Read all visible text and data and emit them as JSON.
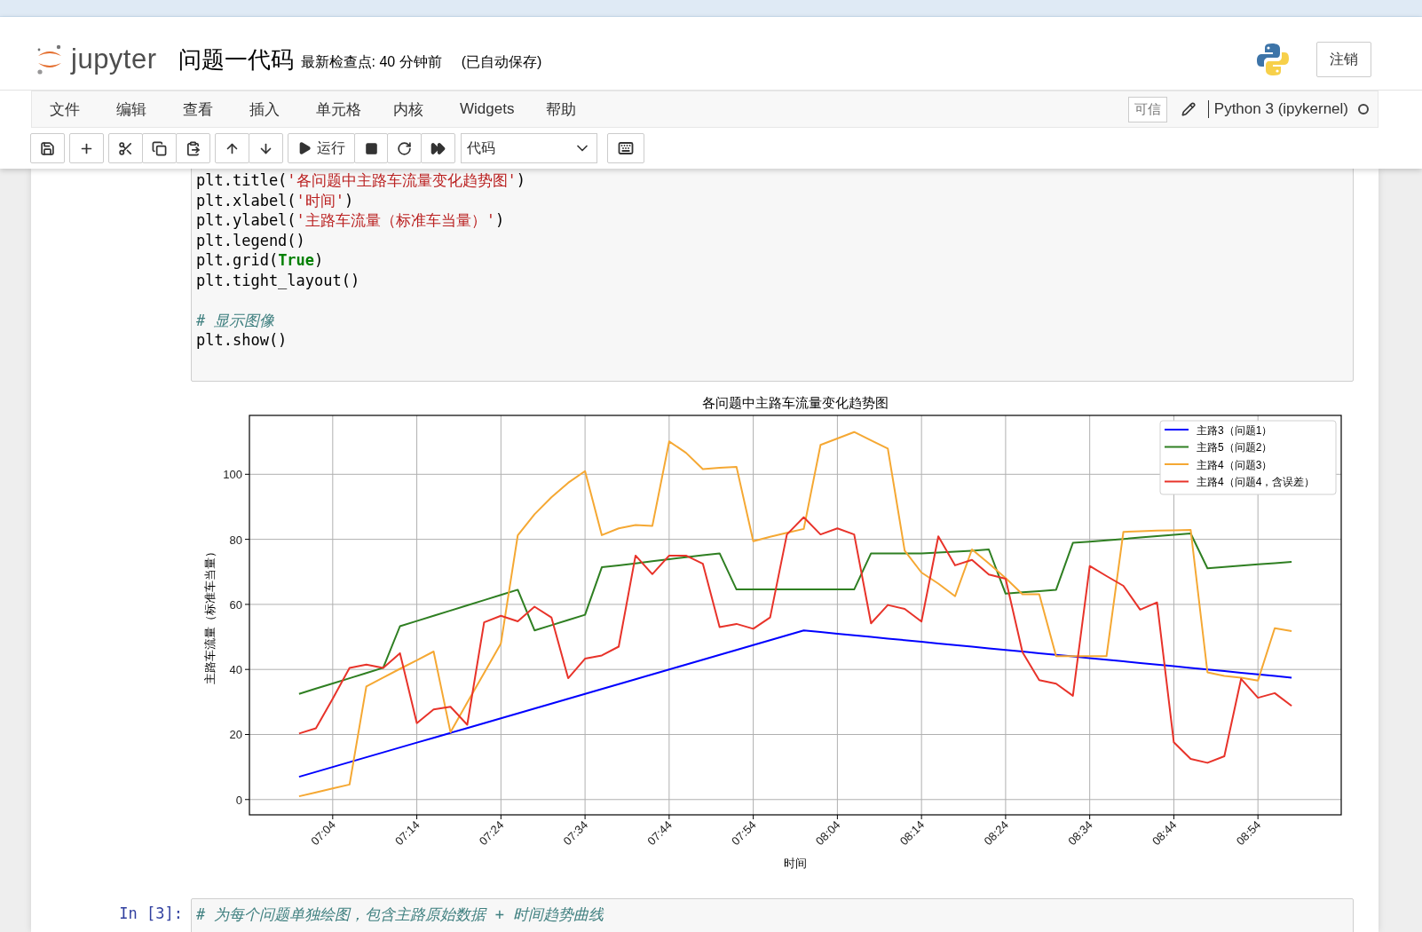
{
  "header": {
    "logo_text": "jupyter",
    "notebook_title": "问题一代码",
    "checkpoint": "最新检查点: 40 分钟前",
    "autosave": "(已自动保存)",
    "logout_button": "注销"
  },
  "menubar": {
    "items": [
      "文件",
      "编辑",
      "查看",
      "插入",
      "单元格",
      "内核",
      "Widgets",
      "帮助"
    ],
    "trusted_badge": "可信",
    "kernel_name": "Python 3 (ipykernel)",
    "kernel_busy": false
  },
  "toolbar": {
    "run_label": "运行",
    "cell_type": "代码"
  },
  "cells": [
    {
      "lines": [
        {
          "tokens": [
            {
              "text": "plt.title(",
              "kind": "plain"
            },
            {
              "text": "'各问题中主路车流量变化趋势图'",
              "kind": "string"
            },
            {
              "text": ")",
              "kind": "plain"
            }
          ]
        },
        {
          "tokens": [
            {
              "text": "plt.xlabel(",
              "kind": "plain"
            },
            {
              "text": "'时间'",
              "kind": "string"
            },
            {
              "text": ")",
              "kind": "plain"
            }
          ]
        },
        {
          "tokens": [
            {
              "text": "plt.ylabel(",
              "kind": "plain"
            },
            {
              "text": "'主路车流量（标准车当量）'",
              "kind": "string"
            },
            {
              "text": ")",
              "kind": "plain"
            }
          ]
        },
        {
          "tokens": [
            {
              "text": "plt.legend()",
              "kind": "plain"
            }
          ]
        },
        {
          "tokens": [
            {
              "text": "plt.grid(",
              "kind": "plain"
            },
            {
              "text": "True",
              "kind": "keyword"
            },
            {
              "text": ")",
              "kind": "plain"
            }
          ]
        },
        {
          "tokens": [
            {
              "text": "plt.tight_layout()",
              "kind": "plain"
            }
          ]
        },
        {
          "gap_before": true,
          "tokens": [
            {
              "text": "# 显示图像",
              "kind": "comment"
            }
          ]
        },
        {
          "tokens": [
            {
              "text": "plt.show()",
              "kind": "plain"
            }
          ]
        }
      ],
      "output": {
        "chart_data": {
          "type": "line",
          "title": "各问题中主路车流量变化趋势图",
          "xlabel": "时间",
          "ylabel": "主路车流量（标准车当量）",
          "x": [
            420,
            422,
            424,
            426,
            428,
            430,
            432,
            434,
            436,
            438,
            440,
            442,
            444,
            446,
            448,
            450,
            452,
            454,
            456,
            458,
            460,
            462,
            464,
            466,
            468,
            470,
            472,
            474,
            476,
            478,
            480,
            482,
            484,
            486,
            488,
            490,
            492,
            494,
            496,
            498,
            500,
            502,
            504,
            506,
            508,
            510,
            512,
            514,
            516,
            518,
            520,
            522,
            524,
            526,
            528,
            530,
            532,
            534,
            536,
            538
          ],
          "xlim": [
            414.1,
            543.9
          ],
          "ylim": [
            -4.7,
            118.1
          ],
          "xticks": [
            {
              "value": 424,
              "label": "07:04"
            },
            {
              "value": 434,
              "label": "07:14"
            },
            {
              "value": 444,
              "label": "07:24"
            },
            {
              "value": 454,
              "label": "07:34"
            },
            {
              "value": 464,
              "label": "07:44"
            },
            {
              "value": 474,
              "label": "07:54"
            },
            {
              "value": 484,
              "label": "08:04"
            },
            {
              "value": 494,
              "label": "08:14"
            },
            {
              "value": 504,
              "label": "08:24"
            },
            {
              "value": 514,
              "label": "08:34"
            },
            {
              "value": 524,
              "label": "08:44"
            },
            {
              "value": 534,
              "label": "08:54"
            }
          ],
          "yticks": [
            0,
            20,
            40,
            60,
            80,
            100
          ],
          "grid": true,
          "legend": true,
          "series": [
            {
              "name": "主路3（问题1）",
              "color": "#0000ff",
              "values": [
                7,
                8.5,
                10,
                11.5,
                13,
                14.5,
                16,
                17.5,
                19,
                20.5,
                22,
                23.5,
                25,
                26.5,
                28,
                29.5,
                31,
                32.5,
                34,
                35.5,
                37,
                38.5,
                40,
                41.5,
                43,
                44.5,
                46,
                47.5,
                49,
                50.5,
                52,
                51.5,
                51,
                50.5,
                50,
                49.5,
                49,
                48.5,
                48,
                47.5,
                47,
                46.5,
                46,
                45.5,
                45,
                44.5,
                44,
                43.5,
                43,
                42.5,
                42,
                41.5,
                41,
                40.5,
                40,
                39.5,
                39,
                38.5,
                38,
                37.5
              ]
            },
            {
              "name": "主路5（问题2）",
              "color": "#2f7f22",
              "values": [
                32.5,
                34.1,
                35.7,
                37.3,
                38.9,
                40.5,
                53.3,
                54.9,
                56.5,
                58.1,
                59.7,
                61.3,
                62.9,
                64.5,
                52.0,
                53.6,
                55.2,
                56.8,
                71.4,
                72.0,
                72.6,
                73.3,
                73.9,
                74.5,
                75.1,
                75.7,
                64.6,
                64.6,
                64.6,
                64.6,
                64.6,
                64.6,
                64.6,
                64.6,
                75.7,
                75.7,
                75.7,
                75.7,
                75.9,
                76.2,
                76.5,
                76.9,
                63.3,
                63.7,
                64.1,
                64.5,
                78.9,
                79.3,
                79.7,
                80.1,
                80.6,
                81.0,
                81.4,
                81.8,
                71.1,
                71.5,
                71.9,
                72.3,
                72.7,
                73.1
              ]
            },
            {
              "name": "主路4（问题3）",
              "color": "#f5a833",
              "values": [
                1.0,
                2.2,
                3.4,
                4.6,
                34.8,
                37.5,
                40.2,
                42.8,
                45.5,
                20.7,
                29.8,
                38.9,
                48.0,
                81.2,
                87.7,
                92.9,
                97.4,
                101.0,
                81.3,
                83.4,
                84.4,
                84.1,
                110.1,
                106.6,
                101.6,
                102.0,
                102.3,
                79.4,
                80.8,
                82.0,
                83.2,
                109.0,
                111.0,
                113.0,
                110.4,
                107.9,
                76.5,
                69.8,
                66.4,
                62.5,
                76.9,
                72.6,
                68.1,
                63.1,
                63.1,
                44.1,
                44.1,
                44.1,
                44.1,
                82.3,
                82.5,
                82.7,
                82.8,
                82.9,
                39.1,
                38.0,
                37.5,
                36.6,
                52.7,
                51.8
              ]
            },
            {
              "name": "主路4（问题4，含误差）",
              "color": "#e8332a",
              "values": [
                20.3,
                21.9,
                31.0,
                40.5,
                41.5,
                40.5,
                45.0,
                23.5,
                27.7,
                28.5,
                23.0,
                54.5,
                56.5,
                54.8,
                59.3,
                56.0,
                37.3,
                43.3,
                44.3,
                47.0,
                75.0,
                69.3,
                75.0,
                75.0,
                72.5,
                53.0,
                54.0,
                52.5,
                56.0,
                81.5,
                86.8,
                81.5,
                83.4,
                81.5,
                54.2,
                59.8,
                58.6,
                54.7,
                80.9,
                72.0,
                73.7,
                69.2,
                67.9,
                45.3,
                36.7,
                35.6,
                31.9,
                71.8,
                68.7,
                65.7,
                58.4,
                60.6,
                17.6,
                12.5,
                11.3,
                13.3,
                37.1,
                31.3,
                32.7,
                28.8
              ]
            }
          ]
        }
      }
    },
    {
      "prompt": "In [3]:",
      "lines": [
        {
          "tokens": [
            {
              "text": "# 为每个问题单独绘图，包含主路原始数据 + 时间趋势曲线",
              "kind": "comment"
            }
          ]
        }
      ]
    }
  ]
}
